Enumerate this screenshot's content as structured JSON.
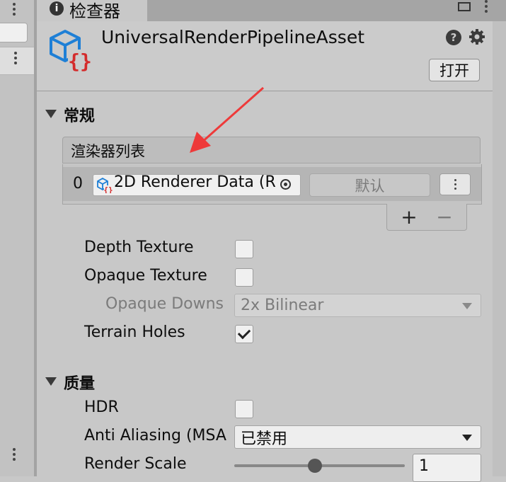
{
  "window": {
    "tab_title": "检查器"
  },
  "asset": {
    "name": "UniversalRenderPipelineAsset",
    "icon": "render-pipeline-asset-icon",
    "open_button_label": "打开"
  },
  "sections": {
    "general": {
      "title": "常规",
      "renderer_list": {
        "title": "渲染器列表",
        "items": [
          {
            "index": "0",
            "object": "2D Renderer Data (R",
            "default_label": "默认"
          }
        ],
        "add_label": "+",
        "remove_label": "−"
      },
      "depth_texture": {
        "label": "Depth Texture",
        "checked": false
      },
      "opaque_texture": {
        "label": "Opaque Texture",
        "checked": false
      },
      "opaque_downsampling": {
        "label": "Opaque Downs",
        "value": "2x Bilinear",
        "disabled": true
      },
      "terrain_holes": {
        "label": "Terrain Holes",
        "checked": true
      }
    },
    "quality": {
      "title": "质量",
      "hdr": {
        "label": "HDR",
        "checked": false
      },
      "anti_aliasing": {
        "label": "Anti Aliasing (MSA",
        "value": "已禁用"
      },
      "render_scale": {
        "label": "Render Scale",
        "value": "1",
        "slider_fraction": 0.5
      }
    }
  },
  "colors": {
    "annotation_arrow": "#ee3a3a",
    "panel_bg": "#c8c8c8",
    "icon_blue": "#1e7fd6",
    "icon_red": "#d42b2b"
  }
}
